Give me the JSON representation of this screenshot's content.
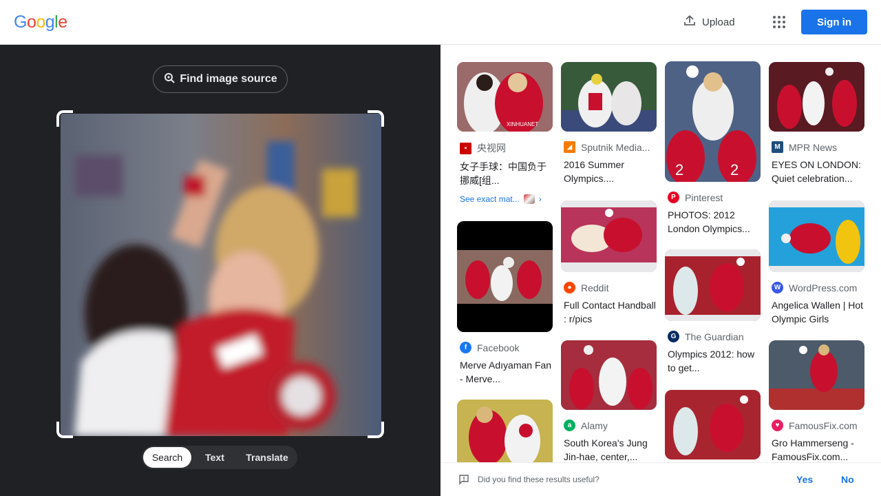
{
  "header": {
    "logo": "Google",
    "upload_label": "Upload",
    "signin_label": "Sign in"
  },
  "lens": {
    "find_source_label": "Find image source",
    "modes": [
      "Search",
      "Text",
      "Translate"
    ],
    "active_mode": "Search"
  },
  "results": [
    {
      "source": "央视网",
      "title": "女子手球：中国负于挪威[组...",
      "exact": "See exact mat..."
    },
    {
      "source": "Facebook",
      "title": "Merve Adıyaman Fan - Merve..."
    },
    {
      "source": "",
      "title": ""
    },
    {
      "source": "Sputnik Media...",
      "title": "2016 Summer Olympics...."
    },
    {
      "source": "Reddit",
      "title": "Full Contact Handball : r/pics"
    },
    {
      "source": "Alamy",
      "title": "South Korea's Jung Jin-hae, center,..."
    },
    {
      "source": "Pinterest",
      "title": "PHOTOS: 2012 London Olympics..."
    },
    {
      "source": "The Guardian",
      "title": "Olympics 2012: how to get..."
    },
    {
      "source": "",
      "title": ""
    },
    {
      "source": "MPR News",
      "title": "EYES ON LONDON: Quiet celebration..."
    },
    {
      "source": "WordPress.com",
      "title": "Angelica Wallen | Hot Olympic Girls"
    },
    {
      "source": "FamousFix.com",
      "title": "Gro Hammerseng - FamousFix.com..."
    }
  ],
  "feedback": {
    "question": "Did you find these results useful?",
    "yes": "Yes",
    "no": "No"
  },
  "colors": {
    "accent": "#1a73e8",
    "dark_panel": "#202124"
  }
}
